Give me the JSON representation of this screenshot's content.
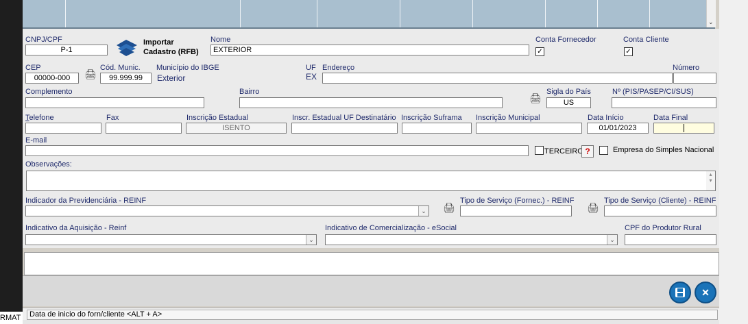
{
  "top_grid": {
    "scroll_arrow": "⌄"
  },
  "form": {
    "cnpj": {
      "label": "CNPJ/CPF",
      "value": "P-1"
    },
    "import": {
      "label_line1": "Importar",
      "label_line2": "Cadastro (RFB)"
    },
    "nome": {
      "label": "Nome",
      "value": "EXTERIOR"
    },
    "conta_fornecedor": {
      "label": "Conta Fornecedor",
      "checked": "✓"
    },
    "conta_cliente": {
      "label": "Conta Cliente",
      "checked": "✓"
    },
    "cep": {
      "label": "CEP",
      "value": "00000-000"
    },
    "cod_munic": {
      "label": "Cód. Munic.",
      "value": "99.999.99"
    },
    "municipio": {
      "label": "Município do IBGE",
      "value": "Exterior"
    },
    "uf": {
      "label": "UF",
      "value": "EX"
    },
    "endereco": {
      "label": "Endereço",
      "value": ""
    },
    "numero": {
      "label": "Número",
      "value": ""
    },
    "complemento": {
      "label": "Complemento",
      "value": ""
    },
    "bairro": {
      "label": "Bairro",
      "value": ""
    },
    "sigla_pais": {
      "label": "Sigla do País",
      "value": "US"
    },
    "pis": {
      "label": "Nº (PIS/PASEP/CI/SUS)",
      "value": ""
    },
    "telefone": {
      "label_first": "T",
      "label_rest": "elefone",
      "value": ""
    },
    "fax": {
      "label": "Fax",
      "value": ""
    },
    "insc_estadual": {
      "label": "Inscrição Estadual",
      "value": "ISENTO"
    },
    "insc_uf_dest": {
      "label": "Inscr. Estadual UF Destinatário",
      "value": ""
    },
    "insc_suframa": {
      "label": "Inscrição Suframa",
      "value": ""
    },
    "insc_municipal": {
      "label": "Inscrição Municipal",
      "value": ""
    },
    "data_inicio": {
      "label": "Data Início",
      "value": "01/01/2023"
    },
    "data_final": {
      "label": "Data Final",
      "value": ""
    },
    "email": {
      "label": "E-mail",
      "value": ""
    },
    "terceiro": {
      "label": "TERCEIRO"
    },
    "help": {
      "label": "?"
    },
    "simples": {
      "label": "Empresa do Simples Nacional"
    },
    "observacoes": {
      "label": "Observações:"
    },
    "indicador_prev": {
      "label": "Indicador da Previdenciária - REINF",
      "value": ""
    },
    "tipo_serv_forn": {
      "label": "Tipo de Serviço (Fornec.) - REINF",
      "value": ""
    },
    "tipo_serv_cli": {
      "label": "Tipo de Serviço (Cliente) - REINF",
      "value": ""
    },
    "indicativo_aquis": {
      "label": "Indicativo da Aquisição - Reinf",
      "value": ""
    },
    "indicativo_comerc": {
      "label": "Indicativo de Comercialização - eSocial",
      "value": ""
    },
    "cpf_produtor": {
      "label": "CPF do Produtor Rural",
      "value": ""
    }
  },
  "buttons": {
    "save_icon": "💾",
    "close_icon": "✕"
  },
  "status": {
    "text": "Data de inicio do forn/cliente <ALT + A>"
  },
  "background_app": {
    "fragment": "RMAT"
  },
  "icons": {
    "lookup": "lookup-icon",
    "combo_arrow": "⌄"
  },
  "colors": {
    "accent": "#1a73b8",
    "label": "#1f2a6b",
    "grid": "#a9bfcf"
  }
}
